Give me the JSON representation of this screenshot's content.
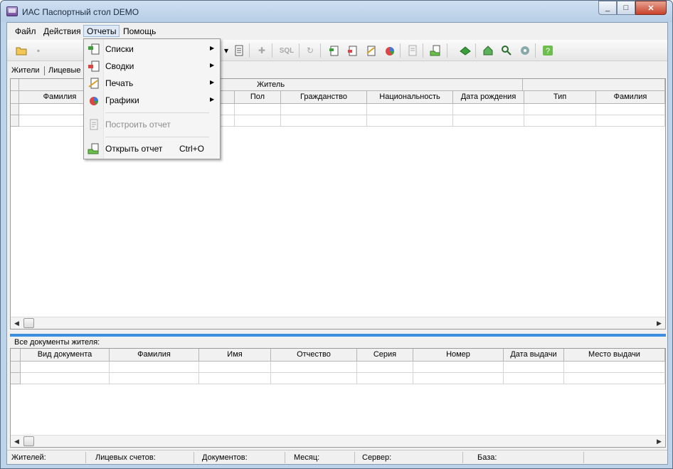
{
  "window": {
    "title": "ИАС Паспортный стол DEMO",
    "min": "_",
    "max": "□",
    "close": "✕"
  },
  "menu": {
    "items": [
      "Файл",
      "Действия",
      "Отчеты",
      "Помощь"
    ]
  },
  "toolbar": {
    "sql_label": "SQL"
  },
  "tabs": {
    "residents": "Жители",
    "accounts": "Лицевые"
  },
  "residents_grid": {
    "group_header": "Житель",
    "columns": [
      "Фамилия",
      "Пол",
      "Гражданство",
      "Национальность",
      "Дата рождения",
      "Тип",
      "Фамилия"
    ]
  },
  "documents": {
    "caption": "Все документы жителя:",
    "columns": [
      "Вид документа",
      "Фамилия",
      "Имя",
      "Отчество",
      "Серия",
      "Номер",
      "Дата выдачи",
      "Место выдачи"
    ]
  },
  "status": {
    "residents": "Жителей:",
    "accounts": "Лицевых счетов:",
    "documents": "Документов:",
    "month": "Месяц:",
    "server": "Сервер:",
    "base": "База:"
  },
  "reports_menu": {
    "lists": "Списки",
    "summaries": "Сводки",
    "print": "Печать",
    "charts": "Графики",
    "build_report": "Построить отчет",
    "open_report": "Открыть отчет",
    "open_shortcut": "Ctrl+O"
  },
  "colors": {
    "accent": "#3b8ee0",
    "close": "#c7422a"
  }
}
